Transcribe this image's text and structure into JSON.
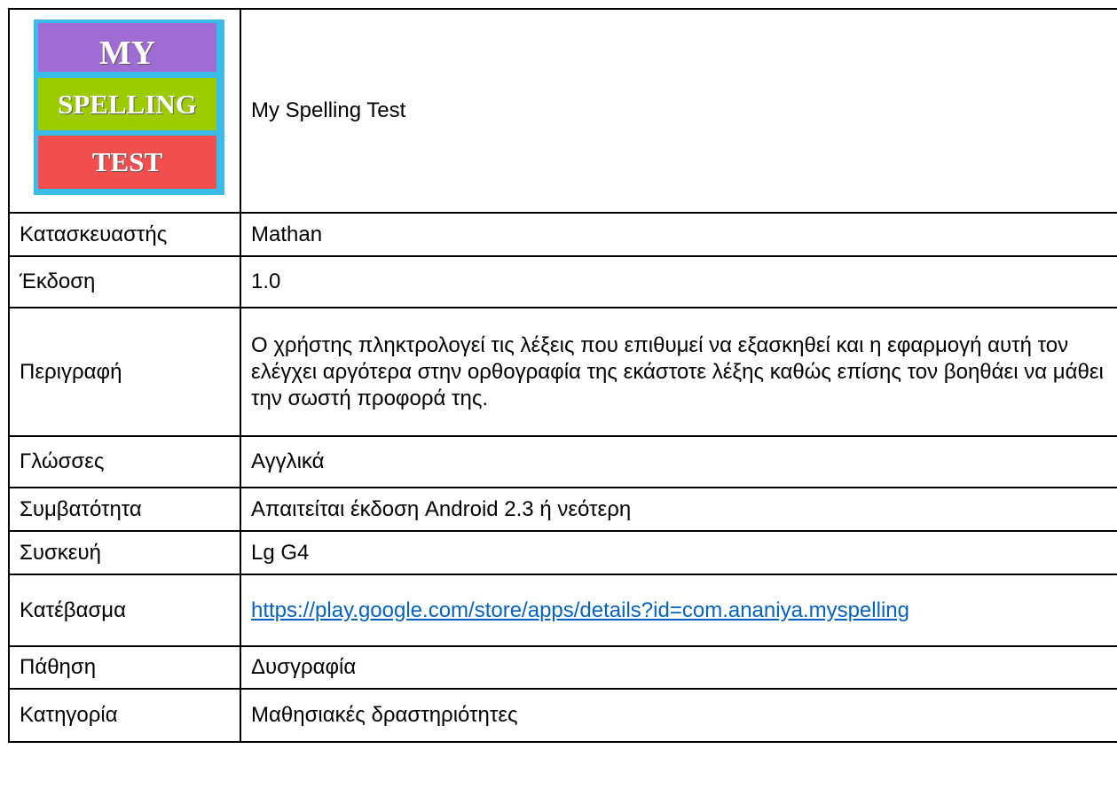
{
  "logo": {
    "line1": "MY",
    "line2": "SPELLING",
    "line3": "TEST",
    "colors": {
      "frame": "#3bbbe8",
      "band1": "#a16bd4",
      "band2": "#9ccc00",
      "band3": "#f34e4e"
    }
  },
  "app_title": "My Spelling Test",
  "rows": [
    {
      "label": "Κατασκευαστής",
      "value": "Mathan"
    },
    {
      "label": "Έκδοση",
      "value": "1.0"
    },
    {
      "label": "Περιγραφή",
      "value": "Ο χρήστης πληκτρολογεί τις λέξεις που επιθυμεί να εξασκηθεί και η εφαρμογή αυτή τον ελέγχει αργότερα στην ορθογραφία της εκάστοτε λέξης καθώς επίσης τον βοηθάει να μάθει την σωστή προφορά της."
    },
    {
      "label": "Γλώσσες",
      "value": "Αγγλικά"
    },
    {
      "label": "Συμβατότητα",
      "value": "Απαιτείται έκδοση Android 2.3 ή νεότερη"
    },
    {
      "label": "Συσκευή",
      "value": "Lg G4"
    },
    {
      "label": "Κατέβασμα",
      "value": "https://play.google.com/store/apps/details?id=com.ananiya.myspelling"
    },
    {
      "label": "Πάθηση",
      "value": "Δυσγραφία"
    },
    {
      "label": "Κατηγορία",
      "value": "Μαθησιακές δραστηριότητες"
    }
  ]
}
